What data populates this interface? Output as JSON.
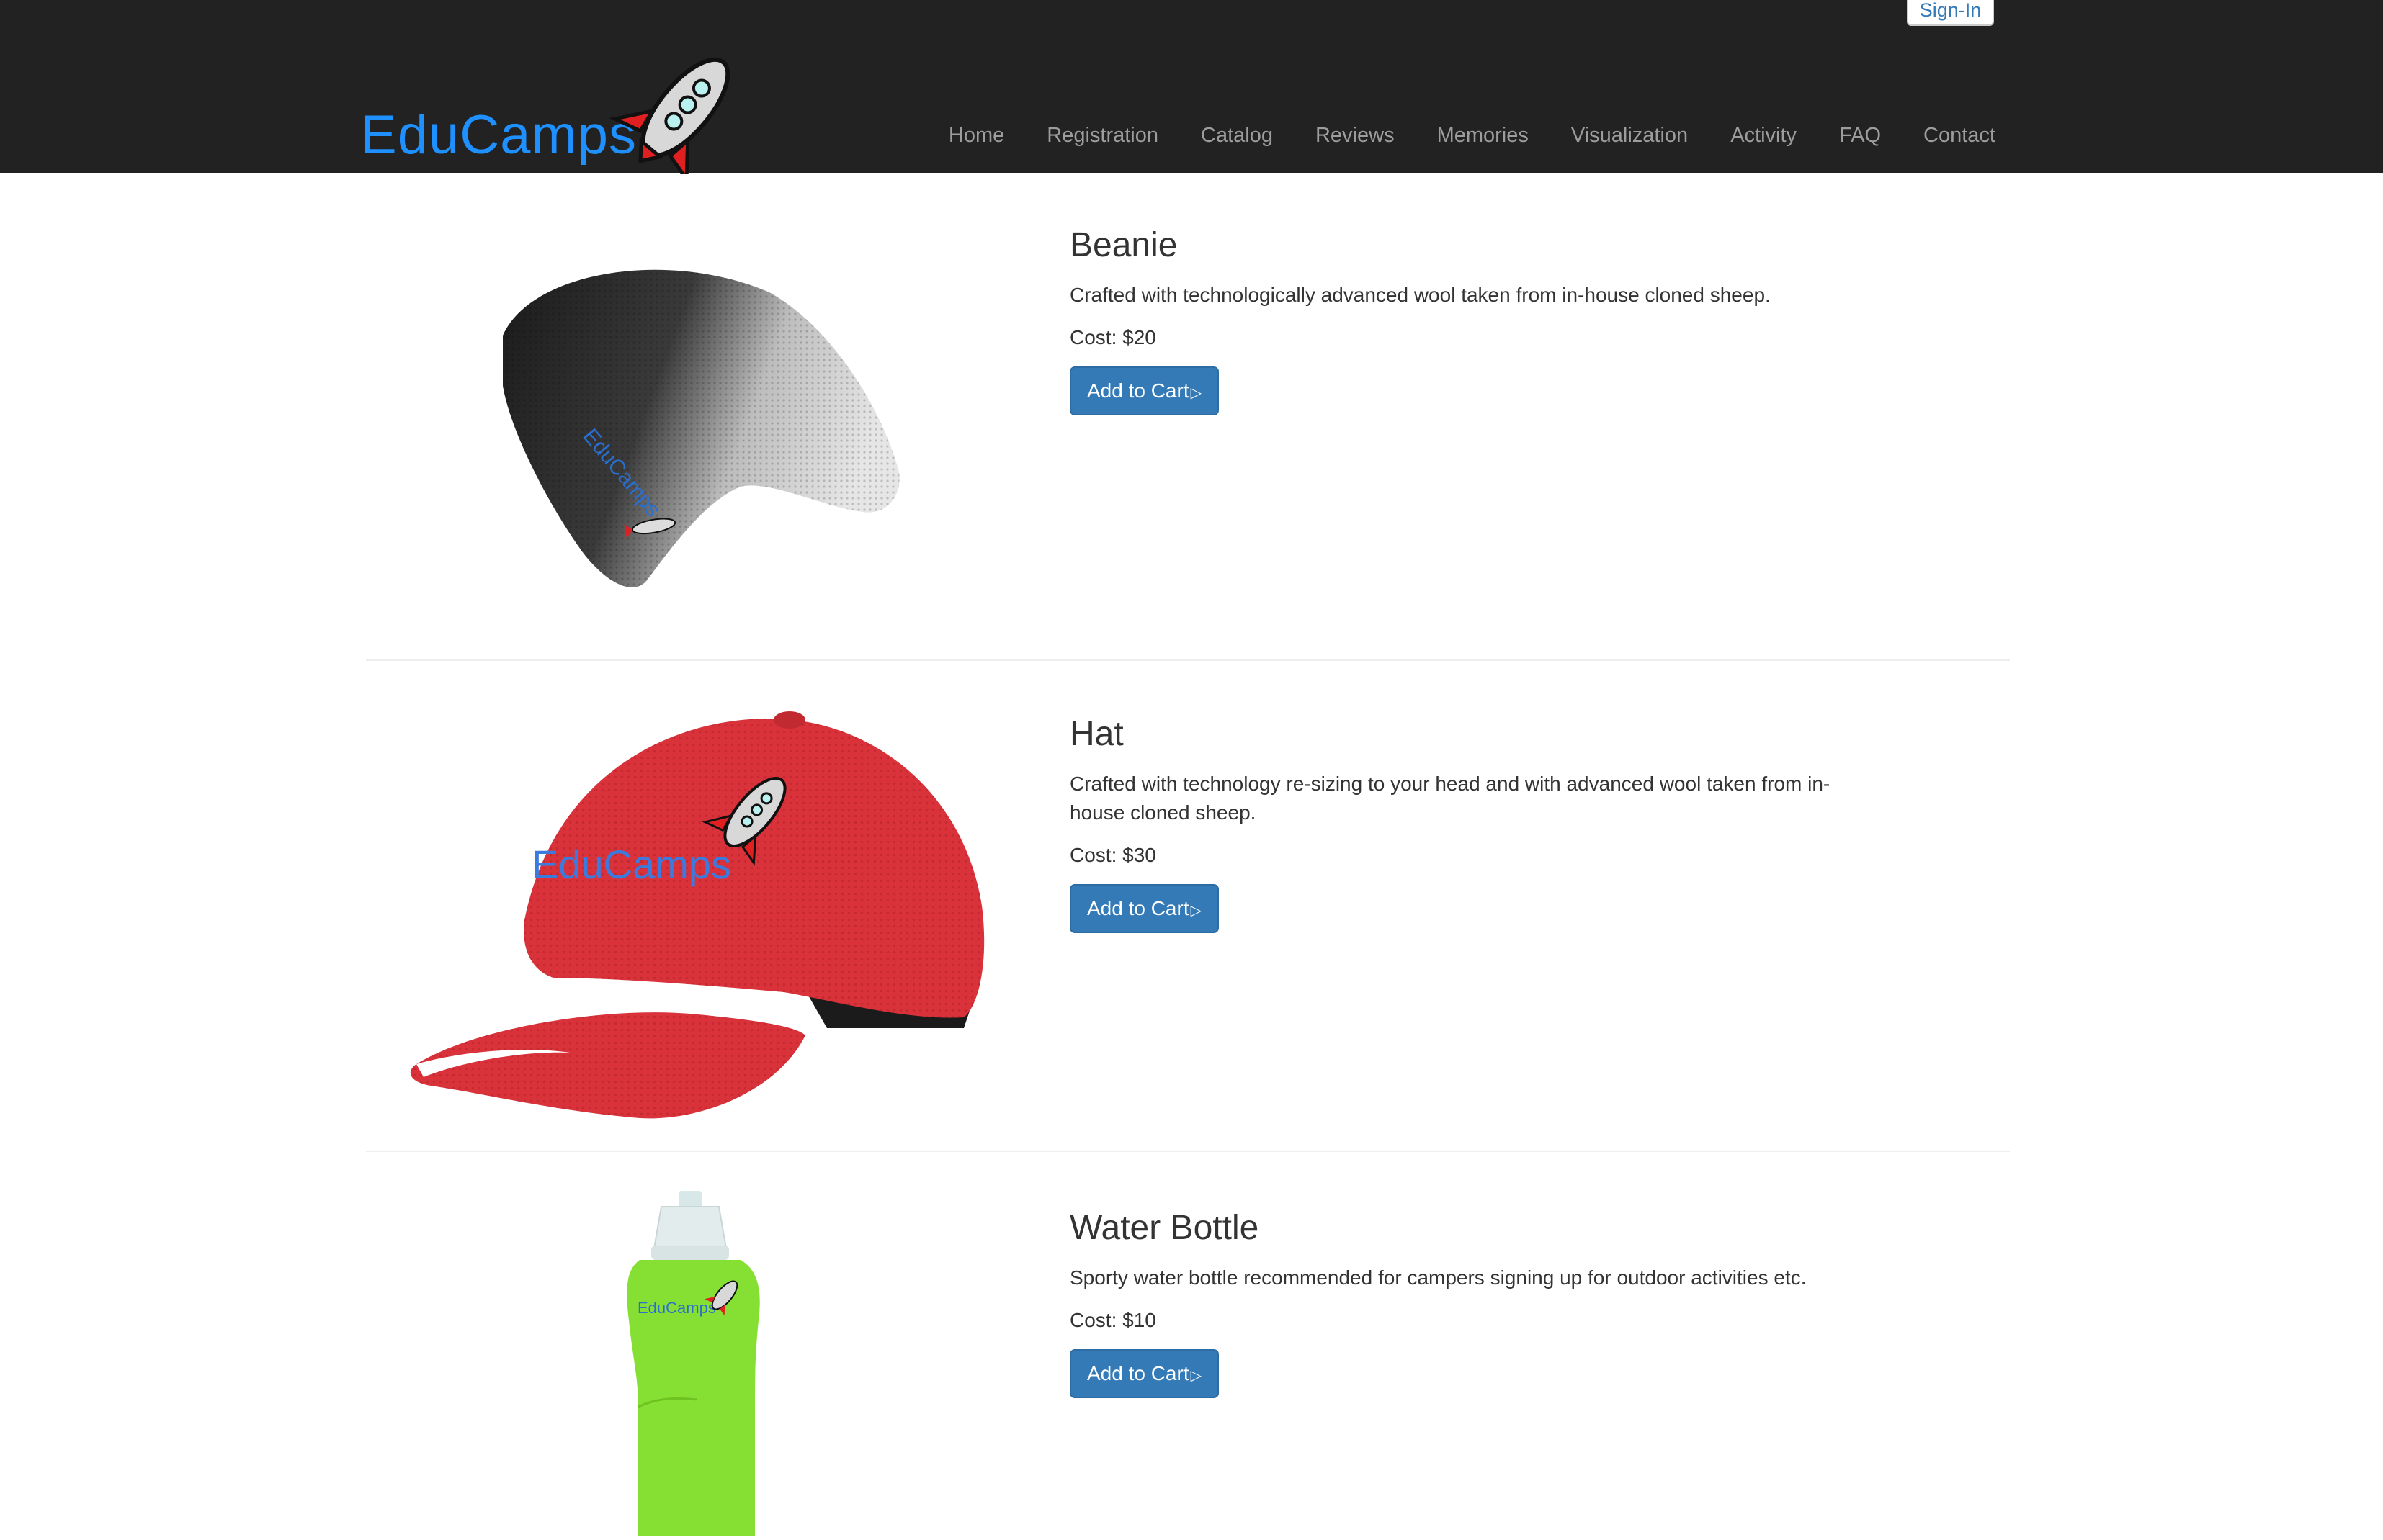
{
  "header": {
    "signin_label": "Sign-In",
    "logo_text": "EduCamps",
    "nav": [
      "Home",
      "Registration",
      "Catalog",
      "Reviews",
      "Memories",
      "Visualization",
      "Activity",
      "FAQ",
      "Contact"
    ]
  },
  "products": [
    {
      "name": "Beanie",
      "description": "Crafted with technologically advanced wool taken from in-house cloned sheep.",
      "cost": "Cost: $20",
      "button": "Add to Cart",
      "image_icon": "beanie-image"
    },
    {
      "name": "Hat",
      "description": "Crafted with technology re-sizing to your head and with advanced wool taken from in-house cloned sheep.",
      "cost": "Cost: $30",
      "button": "Add to Cart",
      "image_icon": "baseball-cap-image"
    },
    {
      "name": "Water Bottle",
      "description": "Sporty water bottle recommended for campers signing up for outdoor activities etc.",
      "cost": "Cost: $10",
      "button": "Add to Cart",
      "image_icon": "water-bottle-image"
    }
  ],
  "colors": {
    "navbar": "#222222",
    "brand_blue": "#1e90ff",
    "button_blue": "#337ab7",
    "hat_red": "#d9323a",
    "bottle_green": "#86e033"
  }
}
